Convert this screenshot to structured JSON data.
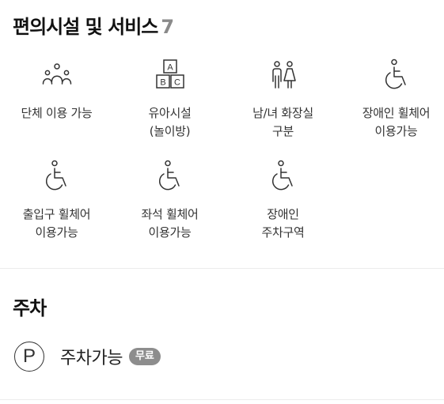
{
  "amenities": {
    "title": "편의시설 및 서비스",
    "count": "7",
    "items": [
      {
        "icon": "group-people-icon",
        "label": "단체 이용 가능"
      },
      {
        "icon": "abc-blocks-icon",
        "label": "유아시설\n(놀이방)"
      },
      {
        "icon": "restroom-icon",
        "label": "남/녀 화장실\n구분"
      },
      {
        "icon": "wheelchair-icon",
        "label": "장애인 휠체어\n이용가능"
      },
      {
        "icon": "wheelchair-icon",
        "label": "출입구 휠체어\n이용가능"
      },
      {
        "icon": "wheelchair-icon",
        "label": "좌석 휠체어\n이용가능"
      },
      {
        "icon": "wheelchair-icon",
        "label": "장애인\n주차구역"
      }
    ]
  },
  "parking": {
    "title": "주차",
    "icon": "parking-icon",
    "icon_letter": "P",
    "label": "주차가능",
    "badge": "무료"
  },
  "colors": {
    "text": "#222222",
    "count": "#8a8a8a",
    "badge_bg": "#8d8d8d"
  }
}
